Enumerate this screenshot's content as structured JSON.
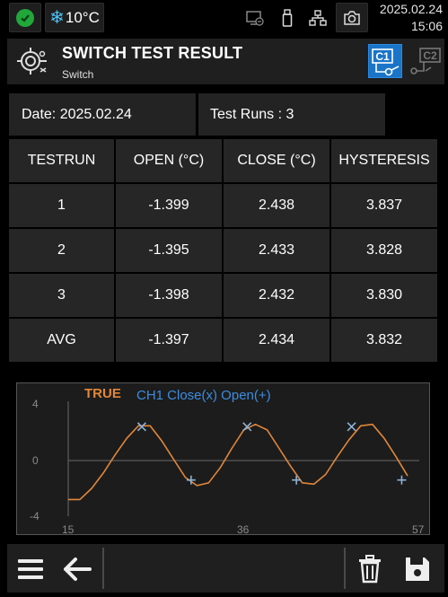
{
  "statusbar": {
    "status_icon": "check-icon",
    "temperature": "10°C",
    "icons": [
      "monitor-icon",
      "usb-icon",
      "network-icon",
      "camera-icon"
    ],
    "date": "2025.02.24",
    "time": "15:06"
  },
  "header": {
    "icon": "switch-test-icon",
    "title": "SWITCH TEST RESULT",
    "subtitle": "Switch",
    "channels": [
      "C1",
      "C2"
    ],
    "active_channel": "C1"
  },
  "info": {
    "date": "Date: 2025.02.24",
    "test_runs": "Test Runs : 3"
  },
  "table": {
    "headers": [
      "TESTRUN",
      "OPEN (°C)",
      "CLOSE (°C)",
      "HYSTERESIS"
    ],
    "rows": [
      [
        "1",
        "-1.399",
        "2.438",
        "3.837"
      ],
      [
        "2",
        "-1.395",
        "2.433",
        "3.828"
      ],
      [
        "3",
        "-1.398",
        "2.432",
        "3.830"
      ],
      [
        "AVG",
        "-1.397",
        "2.434",
        "3.832"
      ]
    ]
  },
  "chart_data": {
    "type": "line",
    "legend": [
      "TRUE",
      "CH1 Close(x) Open(+)"
    ],
    "colors": {
      "true": "#e0873a",
      "ch1": "#3d8de0"
    },
    "x_ticks": [
      "15",
      "36",
      "57"
    ],
    "y_ticks": [
      "4",
      "0",
      "-4"
    ],
    "xlim": [
      15,
      57
    ],
    "ylim": [
      -4,
      4
    ],
    "grid": "horizontal zero line",
    "true_series": [
      [
        15.0,
        -2.8
      ],
      [
        16.4,
        -2.8
      ],
      [
        17.8,
        -2.0
      ],
      [
        19.2,
        -0.9
      ],
      [
        20.6,
        0.4
      ],
      [
        22.0,
        1.6
      ],
      [
        23.4,
        2.5
      ],
      [
        24.8,
        2.5
      ],
      [
        26.2,
        1.4
      ],
      [
        27.6,
        0.1
      ],
      [
        29.0,
        -1.2
      ],
      [
        30.4,
        -1.8
      ],
      [
        31.8,
        -1.6
      ],
      [
        33.2,
        -0.5
      ],
      [
        34.6,
        0.9
      ],
      [
        36.0,
        2.2
      ],
      [
        37.4,
        2.6
      ],
      [
        38.8,
        2.2
      ],
      [
        40.2,
        0.9
      ],
      [
        41.6,
        -0.4
      ],
      [
        43.0,
        -1.6
      ],
      [
        44.4,
        -1.7
      ],
      [
        45.8,
        -1.0
      ],
      [
        47.2,
        0.3
      ],
      [
        48.6,
        1.5
      ],
      [
        50.0,
        2.5
      ],
      [
        51.4,
        2.6
      ],
      [
        52.8,
        1.6
      ],
      [
        54.2,
        0.3
      ],
      [
        55.6,
        -1.1
      ]
    ],
    "close_points": [
      [
        23.8,
        2.43
      ],
      [
        36.4,
        2.43
      ],
      [
        48.9,
        2.43
      ]
    ],
    "open_points": [
      [
        29.7,
        -1.4
      ],
      [
        42.3,
        -1.4
      ],
      [
        54.9,
        -1.4
      ]
    ]
  },
  "footer": {
    "buttons": [
      "menu-icon",
      "back-arrow-icon",
      "trash-icon",
      "save-icon"
    ]
  }
}
